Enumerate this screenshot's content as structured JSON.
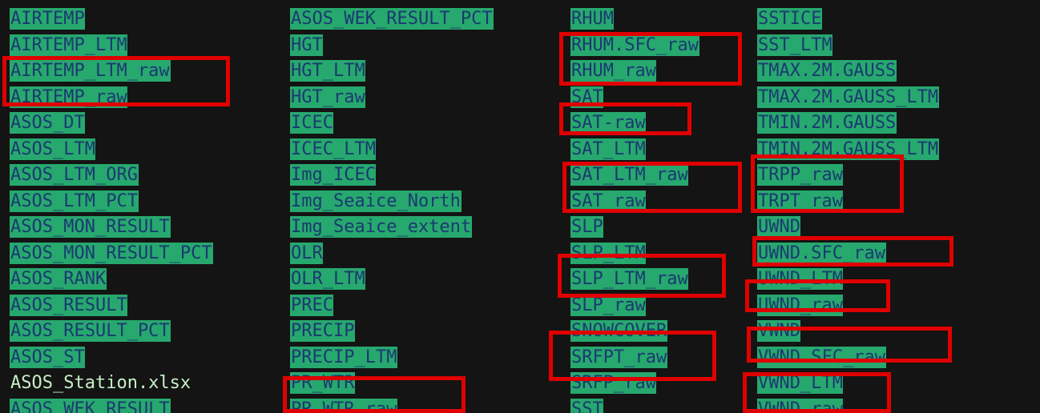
{
  "terminal": {
    "columns": [
      {
        "entries": [
          {
            "name": "AIRTEMP",
            "kind": "dir"
          },
          {
            "name": "AIRTEMP_LTM",
            "kind": "dir"
          },
          {
            "name": "AIRTEMP_LTM_raw",
            "kind": "dir",
            "highlight": 1
          },
          {
            "name": "AIRTEMP_raw",
            "kind": "dir",
            "highlight": 1
          },
          {
            "name": "ASOS_DT",
            "kind": "dir"
          },
          {
            "name": "ASOS_LTM",
            "kind": "dir"
          },
          {
            "name": "ASOS_LTM_ORG",
            "kind": "dir"
          },
          {
            "name": "ASOS_LTM_PCT",
            "kind": "dir"
          },
          {
            "name": "ASOS_MON_RESULT",
            "kind": "dir"
          },
          {
            "name": "ASOS_MON_RESULT_PCT",
            "kind": "dir"
          },
          {
            "name": "ASOS_RANK",
            "kind": "dir"
          },
          {
            "name": "ASOS_RESULT",
            "kind": "dir"
          },
          {
            "name": "ASOS_RESULT_PCT",
            "kind": "dir"
          },
          {
            "name": "ASOS_ST",
            "kind": "dir"
          },
          {
            "name": "ASOS_Station.xlsx",
            "kind": "file"
          },
          {
            "name": "ASOS_WEK_RESULT",
            "kind": "dir"
          }
        ]
      },
      {
        "entries": [
          {
            "name": "ASOS_WEK_RESULT_PCT",
            "kind": "dir"
          },
          {
            "name": "HGT",
            "kind": "dir"
          },
          {
            "name": "HGT_LTM",
            "kind": "dir"
          },
          {
            "name": "HGT_raw",
            "kind": "dir"
          },
          {
            "name": "ICEC",
            "kind": "dir"
          },
          {
            "name": "ICEC_LTM",
            "kind": "dir"
          },
          {
            "name": "Img_ICEC",
            "kind": "dir"
          },
          {
            "name": "Img_Seaice_North",
            "kind": "dir"
          },
          {
            "name": "Img_Seaice_extent",
            "kind": "dir"
          },
          {
            "name": "OLR",
            "kind": "dir"
          },
          {
            "name": "OLR_LTM",
            "kind": "dir"
          },
          {
            "name": "PREC",
            "kind": "dir"
          },
          {
            "name": "PRECIP",
            "kind": "dir"
          },
          {
            "name": "PRECIP_LTM",
            "kind": "dir"
          },
          {
            "name": "PR_WTR",
            "kind": "dir"
          },
          {
            "name": "PR_WTR_raw",
            "kind": "dir",
            "highlight": 1
          }
        ]
      },
      {
        "entries": [
          {
            "name": "RHUM",
            "kind": "dir"
          },
          {
            "name": "RHUM.SFC_raw",
            "kind": "dir",
            "highlight": 1
          },
          {
            "name": "RHUM_raw",
            "kind": "dir",
            "highlight": 1
          },
          {
            "name": "SAT",
            "kind": "dir"
          },
          {
            "name": "SAT-raw",
            "kind": "dir",
            "highlight": 1
          },
          {
            "name": "SAT_LTM",
            "kind": "dir"
          },
          {
            "name": "SAT_LTM_raw",
            "kind": "dir",
            "highlight": 1
          },
          {
            "name": "SAT_raw",
            "kind": "dir",
            "highlight": 1
          },
          {
            "name": "SLP",
            "kind": "dir"
          },
          {
            "name": "SLP_LTM",
            "kind": "dir"
          },
          {
            "name": "SLP_LTM_raw",
            "kind": "dir",
            "highlight": 1
          },
          {
            "name": "SLP_raw",
            "kind": "dir",
            "highlight": 1
          },
          {
            "name": "SNOWCOVER",
            "kind": "dir"
          },
          {
            "name": "SRFPT_raw",
            "kind": "dir",
            "highlight": 1
          },
          {
            "name": "SRFP_raw",
            "kind": "dir",
            "highlight": 1
          },
          {
            "name": "SST",
            "kind": "dir"
          }
        ]
      },
      {
        "entries": [
          {
            "name": "SSTICE",
            "kind": "dir"
          },
          {
            "name": "SST_LTM",
            "kind": "dir"
          },
          {
            "name": "TMAX.2M.GAUSS",
            "kind": "dir"
          },
          {
            "name": "TMAX.2M.GAUSS_LTM",
            "kind": "dir"
          },
          {
            "name": "TMIN.2M.GAUSS",
            "kind": "dir"
          },
          {
            "name": "TMIN.2M.GAUSS_LTM",
            "kind": "dir"
          },
          {
            "name": "TRPP_raw",
            "kind": "dir",
            "highlight": 1
          },
          {
            "name": "TRPT_raw",
            "kind": "dir",
            "highlight": 1
          },
          {
            "name": "UWND",
            "kind": "dir"
          },
          {
            "name": "UWND.SFC_raw",
            "kind": "dir",
            "highlight": 1
          },
          {
            "name": "UWND_LTM",
            "kind": "dir"
          },
          {
            "name": "UWND_raw",
            "kind": "dir",
            "highlight": 1
          },
          {
            "name": "VWND",
            "kind": "dir"
          },
          {
            "name": "VWND.SFC_raw",
            "kind": "dir",
            "highlight": 1
          },
          {
            "name": "VWND_LTM",
            "kind": "dir"
          },
          {
            "name": "VWND_raw",
            "kind": "dir",
            "highlight": 1
          }
        ]
      }
    ]
  },
  "colors": {
    "background": "#141414",
    "dir_background": "#27a86e",
    "dir_text": "#1a3a70",
    "file_text": "#c6f0c6",
    "highlight_box": "#e00000"
  }
}
